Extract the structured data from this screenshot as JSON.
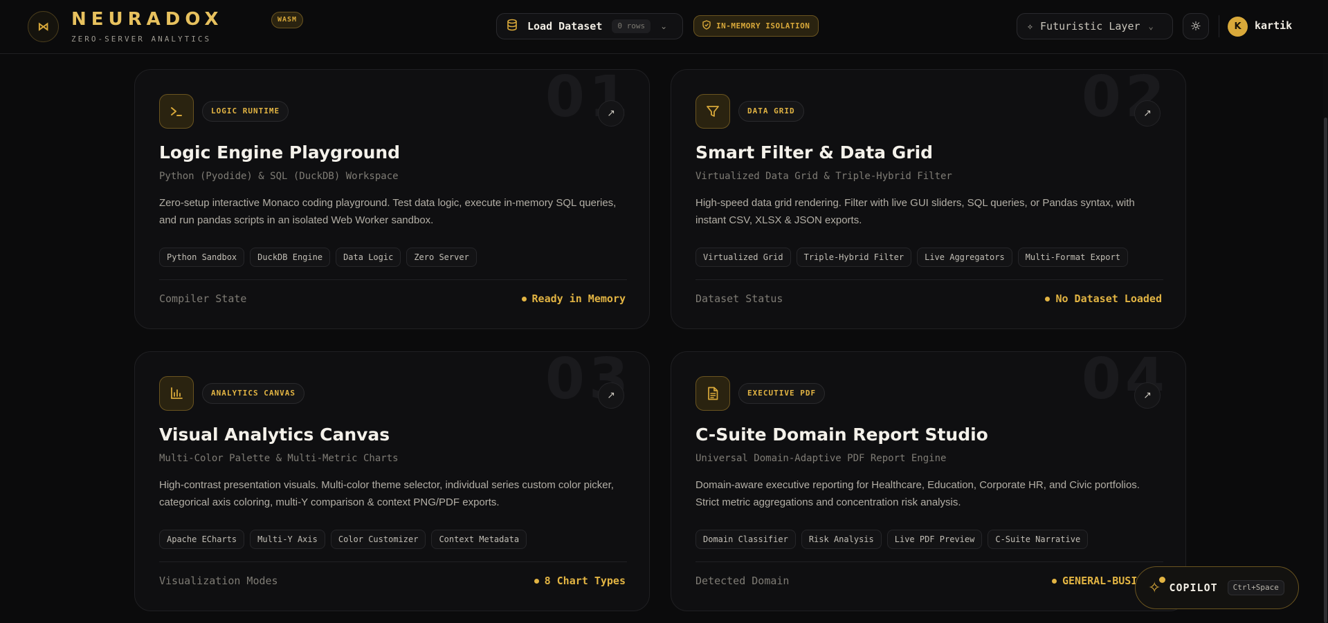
{
  "header": {
    "brand": "NEURADOX",
    "badge": "WASM",
    "tagline": "ZERO-SERVER ANALYTICS",
    "load_label": "Load Dataset",
    "rows": "0 rows",
    "isolation": "IN-MEMORY ISOLATION",
    "layer": "Futuristic Layer",
    "avatar_initial": "K",
    "username": "kartik"
  },
  "cards": [
    {
      "number": "01",
      "icon": "terminal-icon",
      "category": "LOGIC RUNTIME",
      "title": "Logic Engine Playground",
      "subtitle": "Python (Pyodide) & SQL (DuckDB) Workspace",
      "description": "Zero-setup interactive Monaco coding playground. Test data logic, execute in-memory SQL queries, and run pandas scripts in an isolated Web Worker sandbox.",
      "tags": [
        "Python Sandbox",
        "DuckDB Engine",
        "Data Logic",
        "Zero Server"
      ],
      "status_label": "Compiler State",
      "status_value": "Ready in Memory"
    },
    {
      "number": "02",
      "icon": "filter-icon",
      "category": "DATA GRID",
      "title": "Smart Filter & Data Grid",
      "subtitle": "Virtualized Data Grid & Triple-Hybrid Filter",
      "description": "High-speed data grid rendering. Filter with live GUI sliders, SQL queries, or Pandas syntax, with instant CSV, XLSX & JSON exports.",
      "tags": [
        "Virtualized Grid",
        "Triple-Hybrid Filter",
        "Live Aggregators",
        "Multi-Format Export"
      ],
      "status_label": "Dataset Status",
      "status_value": "No Dataset Loaded"
    },
    {
      "number": "03",
      "icon": "bar-chart-icon",
      "category": "ANALYTICS CANVAS",
      "title": "Visual Analytics Canvas",
      "subtitle": "Multi-Color Palette & Multi-Metric Charts",
      "description": "High-contrast presentation visuals. Multi-color theme selector, individual series custom color picker, categorical axis coloring, multi-Y comparison & context PNG/PDF exports.",
      "tags": [
        "Apache ECharts",
        "Multi-Y Axis",
        "Color Customizer",
        "Context Metadata"
      ],
      "status_label": "Visualization Modes",
      "status_value": "8 Chart Types"
    },
    {
      "number": "04",
      "icon": "document-icon",
      "category": "EXECUTIVE PDF",
      "title": "C-Suite Domain Report Studio",
      "subtitle": "Universal Domain-Adaptive PDF Report Engine",
      "description": "Domain-aware executive reporting for Healthcare, Education, Corporate HR, and Civic portfolios. Strict metric aggregations and concentration risk analysis.",
      "tags": [
        "Domain Classifier",
        "Risk Analysis",
        "Live PDF Preview",
        "C-Suite Narrative"
      ],
      "status_label": "Detected Domain",
      "status_value": "GENERAL-BUSI"
    }
  ],
  "copilot": {
    "label": "COPILOT",
    "shortcut": "Ctrl+Space"
  },
  "colors": {
    "accent": "#e2b443",
    "background": "#0b0b0c",
    "card": "#0f0f11"
  }
}
